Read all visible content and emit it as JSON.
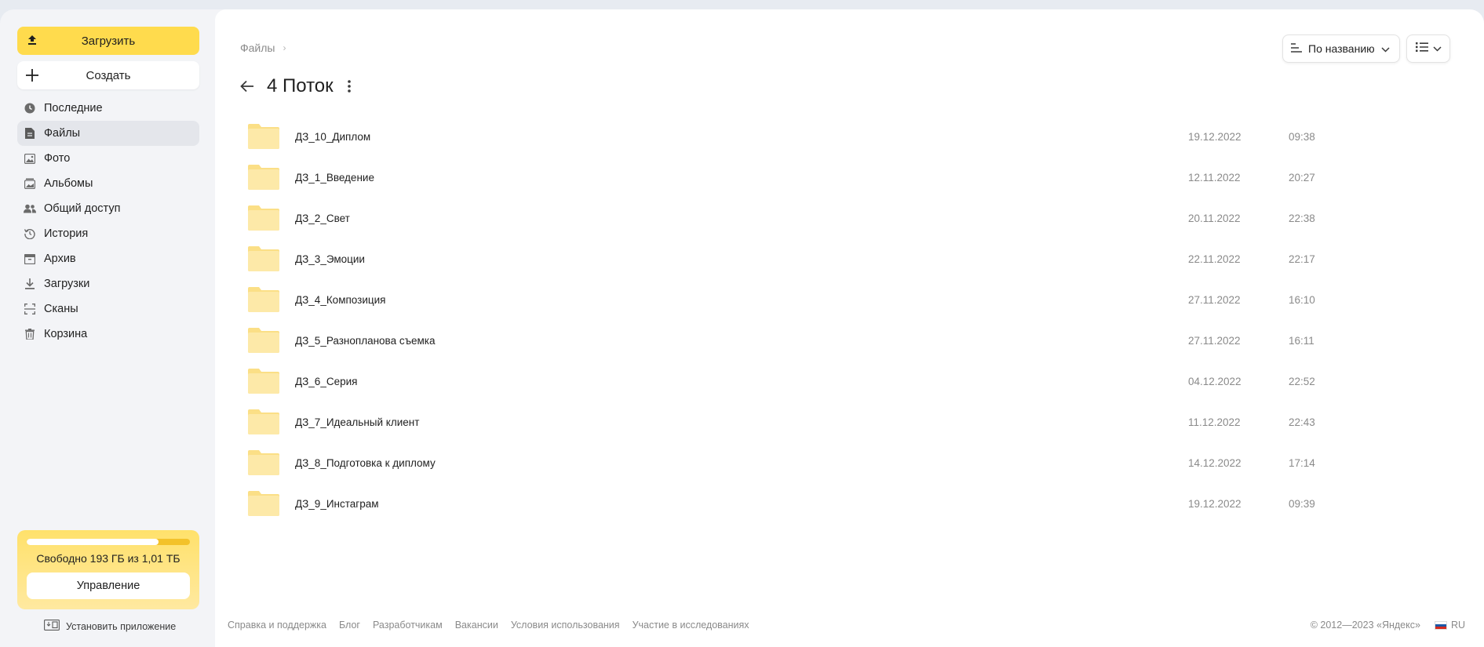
{
  "sidebar": {
    "upload_label": "Загрузить",
    "create_label": "Создать",
    "items": [
      {
        "label": "Последние",
        "icon": "clock-icon"
      },
      {
        "label": "Файлы",
        "icon": "file-icon",
        "active": true
      },
      {
        "label": "Фото",
        "icon": "photo-icon"
      },
      {
        "label": "Альбомы",
        "icon": "albums-icon"
      },
      {
        "label": "Общий доступ",
        "icon": "shared-icon"
      },
      {
        "label": "История",
        "icon": "history-icon"
      },
      {
        "label": "Архив",
        "icon": "archive-icon"
      },
      {
        "label": "Загрузки",
        "icon": "download-icon"
      },
      {
        "label": "Сканы",
        "icon": "scan-icon"
      },
      {
        "label": "Корзина",
        "icon": "trash-icon"
      }
    ],
    "storage": {
      "text": "Свободно 193 ГБ из 1,01 ТБ",
      "used_fraction": 0.81,
      "manage_label": "Управление"
    },
    "install_label": "Установить приложение"
  },
  "main": {
    "breadcrumb": "Файлы",
    "title": "4 Поток",
    "sort_label": "По названию",
    "files": [
      {
        "name": "ДЗ_10_Диплом",
        "date": "19.12.2022",
        "time": "09:38"
      },
      {
        "name": "ДЗ_1_Введение",
        "date": "12.11.2022",
        "time": "20:27"
      },
      {
        "name": "ДЗ_2_Свет",
        "date": "20.11.2022",
        "time": "22:38"
      },
      {
        "name": "ДЗ_3_Эмоции",
        "date": "22.11.2022",
        "time": "22:17"
      },
      {
        "name": "ДЗ_4_Композиция",
        "date": "27.11.2022",
        "time": "16:10"
      },
      {
        "name": "ДЗ_5_Разнопланова съемка",
        "date": "27.11.2022",
        "time": "16:11"
      },
      {
        "name": "ДЗ_6_Серия",
        "date": "04.12.2022",
        "time": "22:52"
      },
      {
        "name": "ДЗ_7_Идеальный клиент",
        "date": "11.12.2022",
        "time": "22:43"
      },
      {
        "name": "ДЗ_8_Подготовка к диплому",
        "date": "14.12.2022",
        "time": "17:14"
      },
      {
        "name": "ДЗ_9_Инстаграм",
        "date": "19.12.2022",
        "time": "09:39"
      }
    ]
  },
  "footer": {
    "links": [
      "Справка и поддержка",
      "Блог",
      "Разработчикам",
      "Вакансии",
      "Условия использования",
      "Участие в исследованиях"
    ],
    "copyright": "© 2012—2023 «Яндекс»",
    "lang": "RU"
  },
  "colors": {
    "accent": "#ffdb4d",
    "folder": "#fde9a8",
    "folder_tab": "#fbdf86"
  }
}
